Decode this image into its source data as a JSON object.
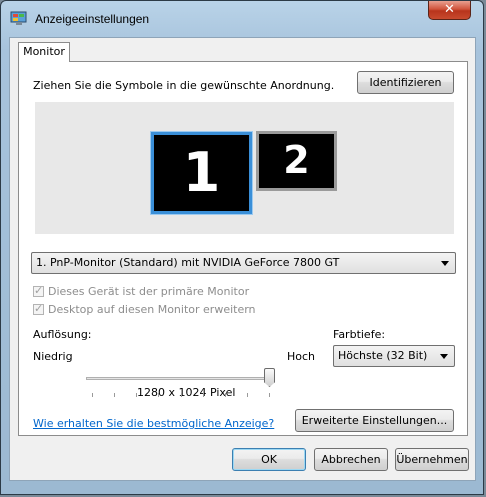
{
  "window": {
    "title": "Anzeigeeinstellungen",
    "close_glyph": "✕"
  },
  "tab": {
    "label": "Monitor"
  },
  "instructions": "Ziehen Sie die Symbole in die gewünschte Anordnung.",
  "identify_button": "Identifizieren",
  "monitors": [
    {
      "number": "1"
    },
    {
      "number": "2"
    }
  ],
  "monitor_select": {
    "value": "1. PnP-Monitor (Standard) mit NVIDIA GeForce 7800 GT"
  },
  "options": {
    "primary": "Dieses Gerät ist der primäre Monitor",
    "extend": "Desktop auf diesen Monitor erweitern"
  },
  "resolution": {
    "label": "Auflösung:",
    "low": "Niedrig",
    "high": "Hoch",
    "value": "1280 x 1024 Pixel",
    "slider_fraction": 1.0
  },
  "color_depth": {
    "label": "Farbtiefe:",
    "value": "Höchste (32 Bit)"
  },
  "help_link": "Wie erhalten Sie die bestmögliche Anzeige?",
  "advanced_button": "Erweiterte Einstellungen...",
  "footer": {
    "ok": "OK",
    "cancel": "Abbrechen",
    "apply": "Übernehmen"
  },
  "colors": {
    "accent": "#3a8fd8",
    "link": "#0066cc"
  }
}
